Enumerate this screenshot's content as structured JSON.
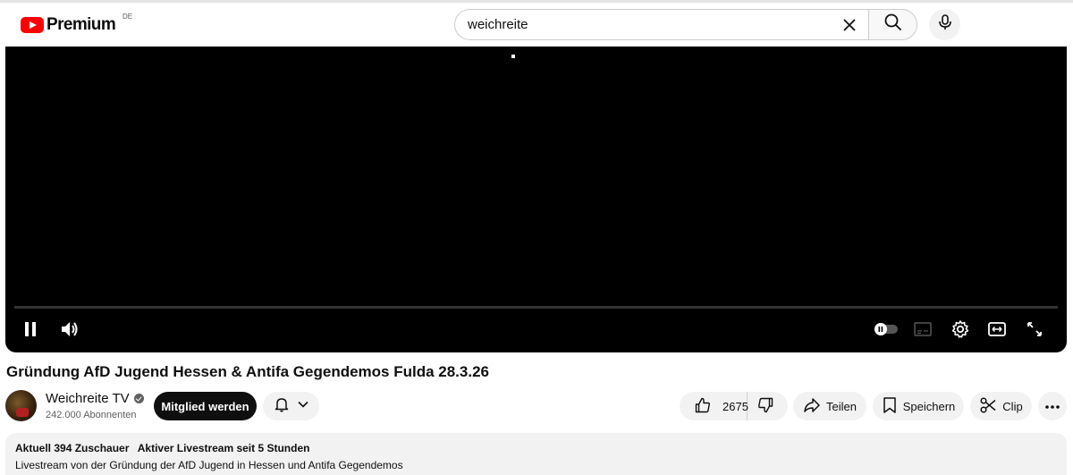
{
  "header": {
    "logo_text": "Premium",
    "logo_country": "DE",
    "search_value": "weichreite"
  },
  "video": {
    "title": "Gründung AfD Jugend Hessen & Antifa Gegendemos Fulda 28.3.26"
  },
  "channel": {
    "name": "Weichreite TV",
    "subscribers": "242.000 Abonnenten",
    "join_label": "Mitglied werden"
  },
  "actions": {
    "like_count": "2675",
    "share_label": "Teilen",
    "save_label": "Speichern",
    "clip_label": "Clip"
  },
  "description": {
    "viewers": "Aktuell 394 Zuschauer",
    "live_status": "Aktiver Livestream seit 5 Stunden",
    "text": "Livestream von der Gründung der AfD Jugend in Hessen und Antifa Gegendemos"
  },
  "icons": {
    "logo": "youtube-logo-icon",
    "clear": "close-icon",
    "search": "search-icon",
    "mic": "mic-icon",
    "pause": "pause-icon",
    "volume": "volume-icon",
    "autoplay": "autoplay-toggle-icon",
    "subtitles": "subtitles-icon",
    "settings": "gear-icon",
    "theater": "theater-mode-icon",
    "fullscreen": "fullscreen-icon",
    "bell": "bell-icon",
    "chevron": "chevron-down-icon",
    "like": "thumbs-up-icon",
    "dislike": "thumbs-down-icon",
    "share": "share-icon",
    "save": "bookmark-icon",
    "clip": "scissors-icon",
    "more": "more-horizontal-icon"
  },
  "colors": {
    "brand": "#ff0000",
    "button_dark": "#0f0f0f",
    "pill_bg": "#f2f2f2",
    "player_bg": "#000000"
  }
}
